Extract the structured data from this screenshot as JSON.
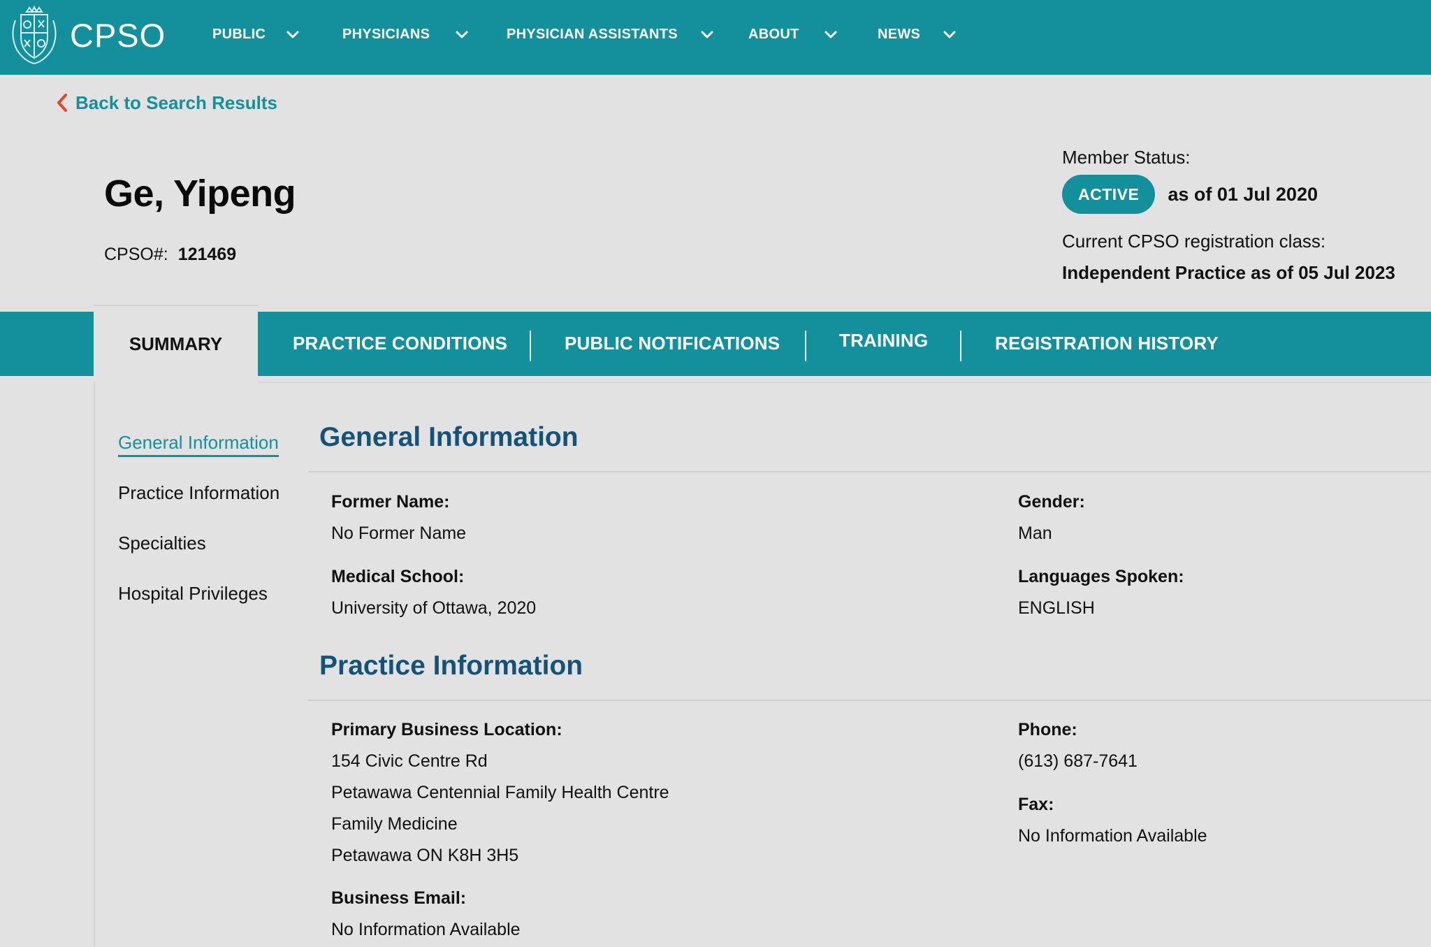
{
  "nav": {
    "logo_text": "CPSO",
    "items": [
      {
        "label": "PUBLIC"
      },
      {
        "label": "PHYSICIANS"
      },
      {
        "label": "PHYSICIAN ASSISTANTS"
      },
      {
        "label": "ABOUT"
      },
      {
        "label": "NEWS"
      }
    ]
  },
  "back_link": "Back to Search Results",
  "physician": {
    "name": "Ge, Yipeng",
    "cpso_label": "CPSO#:",
    "cpso_number": "121469"
  },
  "status": {
    "label": "Member Status:",
    "badge": "ACTIVE",
    "date": "as of 01 Jul 2020",
    "reg_label": "Current CPSO registration class:",
    "reg_value": "Independent Practice as of 05 Jul 2023"
  },
  "tabs": [
    {
      "label": "SUMMARY",
      "active": true
    },
    {
      "label": "PRACTICE CONDITIONS"
    },
    {
      "label": "PUBLIC NOTIFICATIONS"
    },
    {
      "label": "TRAINING"
    },
    {
      "label": "REGISTRATION HISTORY"
    }
  ],
  "sidebar": [
    {
      "label": "General Information",
      "active": true
    },
    {
      "label": "Practice Information"
    },
    {
      "label": "Specialties"
    },
    {
      "label": "Hospital Privileges"
    }
  ],
  "general": {
    "title": "General Information",
    "former_name_label": "Former Name:",
    "former_name": "No Former Name",
    "medical_school_label": "Medical School:",
    "medical_school": "University of Ottawa, 2020",
    "gender_label": "Gender:",
    "gender": "Man",
    "languages_label": "Languages Spoken:",
    "languages": "ENGLISH"
  },
  "practice": {
    "title": "Practice Information",
    "location_label": "Primary Business Location:",
    "address": [
      "154 Civic Centre Rd",
      "Petawawa Centennial Family Health Centre",
      "Family Medicine",
      "Petawawa ON K8H 3H5"
    ],
    "email_label": "Business Email:",
    "email": "No Information Available",
    "phone_label": "Phone:",
    "phone": "(613) 687-7641",
    "fax_label": "Fax:",
    "fax": "No Information Available"
  },
  "colors": {
    "brand_teal": "#14909c",
    "heading_blue": "#14527a",
    "back_arrow": "#e0442a",
    "background": "#e2e2e2"
  }
}
